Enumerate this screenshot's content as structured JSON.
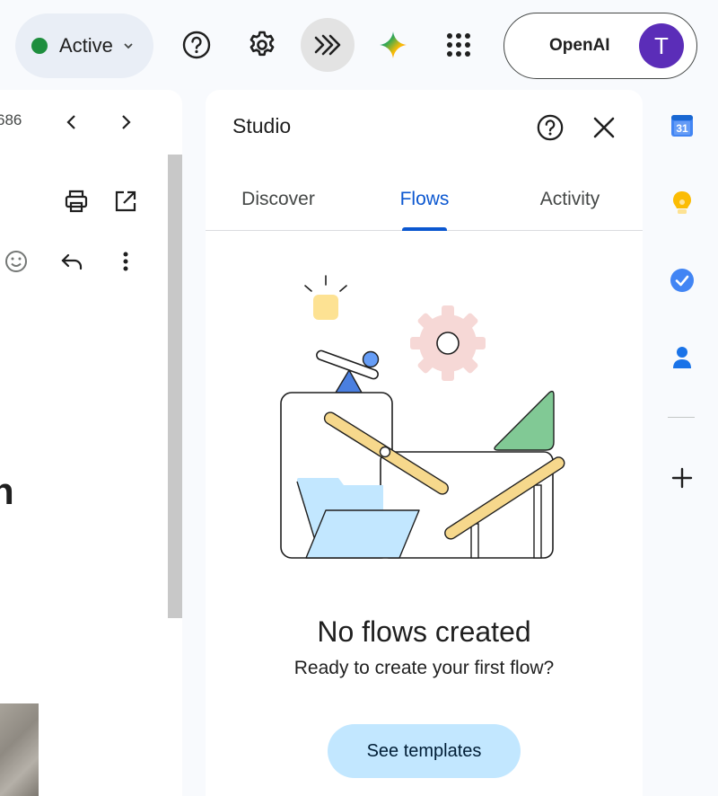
{
  "topbar": {
    "status_label": "Active",
    "status_color": "#1e8e3e",
    "icons": [
      "help-icon",
      "settings-icon",
      "flows-icon",
      "gemini-icon",
      "apps-grid-icon"
    ],
    "account": {
      "org": "OpenAI",
      "avatar_letter": "T",
      "avatar_color": "#5b2db8"
    }
  },
  "mail": {
    "page_count": "686",
    "big_text": "n",
    "icons": [
      "chevron-left-icon",
      "chevron-right-icon",
      "print-icon",
      "open-in-new-icon",
      "emoji-icon",
      "reply-icon",
      "more-vert-icon"
    ]
  },
  "studio": {
    "title": "Studio",
    "tabs": [
      {
        "label": "Discover",
        "selected": false
      },
      {
        "label": "Flows",
        "selected": true
      },
      {
        "label": "Activity",
        "selected": false
      }
    ],
    "empty_title": "No flows created",
    "empty_subtitle": "Ready to create your first flow?",
    "templates_button": "See templates",
    "accent_color": "#0b57d0"
  },
  "rail": {
    "calendar_day": "31",
    "icons": [
      "calendar-icon",
      "keep-icon",
      "tasks-icon",
      "contacts-icon",
      "add-icon"
    ]
  }
}
